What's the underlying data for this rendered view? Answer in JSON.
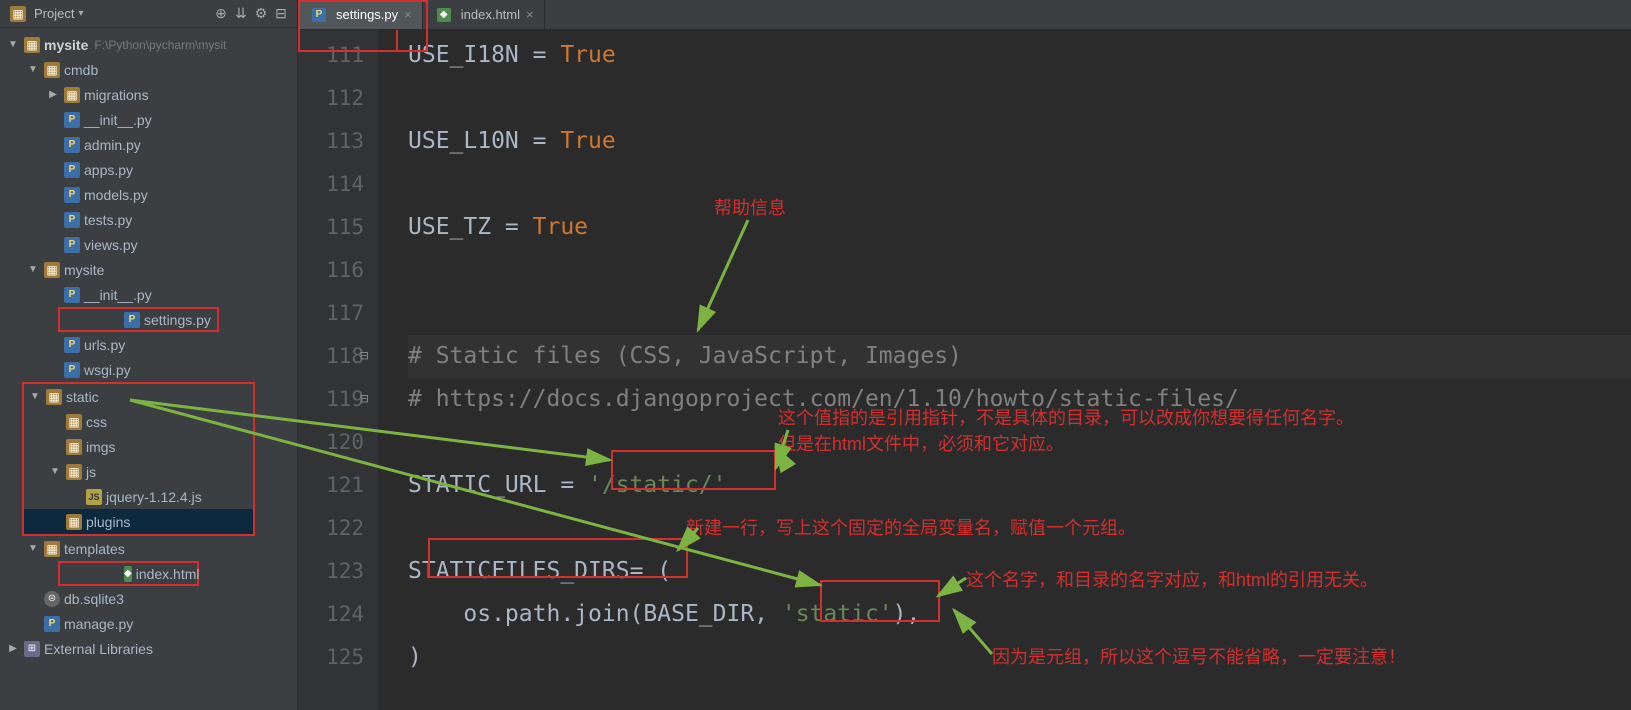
{
  "sidebar": {
    "title": "Project",
    "root": {
      "name": "mysite",
      "path": "F:\\Python\\pycharm\\mysit"
    },
    "tree": {
      "cmdb": "cmdb",
      "migrations": "migrations",
      "init": "__init__.py",
      "admin": "admin.py",
      "apps": "apps.py",
      "models": "models.py",
      "tests": "tests.py",
      "views": "views.py",
      "mysite": "mysite",
      "settings": "settings.py",
      "urls": "urls.py",
      "wsgi": "wsgi.py",
      "static": "static",
      "css": "css",
      "imgs": "imgs",
      "js": "js",
      "jquery": "jquery-1.12.4.js",
      "plugins": "plugins",
      "templates": "templates",
      "index": "index.html",
      "db": "db.sqlite3",
      "manage": "manage.py",
      "extlib": "External Libraries"
    }
  },
  "tabs": {
    "settings": "settings.py",
    "index": "index.html"
  },
  "code": {
    "l111": {
      "a": "USE_I18N = ",
      "b": "True"
    },
    "l113": {
      "a": "USE_L10N = ",
      "b": "True"
    },
    "l115": {
      "a": "USE_TZ = ",
      "b": "True"
    },
    "l118": "# Static files (CSS, JavaScript, Images)",
    "l119": "# https://docs.djangoproject.com/en/1.10/howto/static-files/",
    "l121": {
      "a": "STATIC_URL = ",
      "b": "'/static/'"
    },
    "l123": {
      "a": "STATICFILES_DIRS",
      "b": "= ("
    },
    "l124": {
      "a": "    os.path.join(BASE_DIR, ",
      "b": "'static'",
      "c": "),"
    },
    "l125": ")"
  },
  "lines": [
    "111",
    "112",
    "113",
    "114",
    "115",
    "116",
    "117",
    "118",
    "119",
    "120",
    "121",
    "122",
    "123",
    "124",
    "125"
  ],
  "annot": {
    "help": "帮助信息",
    "pointer1": "这个值指的是引用指针，不是具体的目录，可以改成你想要得任何名字。",
    "pointer2": "但是在html文件中，必须和它对应。",
    "newline": "新建一行，写上这个固定的全局变量名，赋值一个元组。",
    "dirname": "这个名字，和目录的名字对应，和html的引用无关。",
    "tuple": "因为是元组，所以这个逗号不能省略，一定要注意！"
  }
}
